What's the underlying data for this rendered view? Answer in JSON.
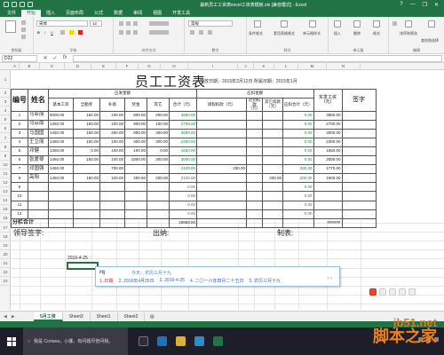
{
  "window": {
    "title": "最新员工工资表excel工资表模板.xls [兼容模式] - Excel",
    "minimize": "—",
    "restore": "❐",
    "close": "✕",
    "help": "?"
  },
  "tabs": [
    "文件",
    "开始",
    "插入",
    "页面布局",
    "公式",
    "数据",
    "审阅",
    "视图",
    "开发工具"
  ],
  "active_tab": "开始",
  "ribbon": {
    "groups": [
      "剪贴板",
      "字体",
      "对齐方式",
      "数字",
      "样式",
      "单元格",
      "编辑"
    ],
    "font_name": "宋体",
    "font_size": "12",
    "number_format": "常规",
    "styles": [
      "条件格式",
      "套用表格格式",
      "单元格样式"
    ],
    "cells": [
      "插入",
      "删除",
      "格式"
    ],
    "editing": [
      "排序和筛选",
      "查找和选择"
    ]
  },
  "formula_bar": {
    "name_box": "D22",
    "cancel": "✕",
    "enter": "✓",
    "fx": "fx"
  },
  "columns": [
    "A",
    "B",
    "C",
    "D",
    "E",
    "F",
    "G",
    "H",
    "I",
    "J",
    "K",
    "L",
    "M",
    "N"
  ],
  "rows": [
    "1",
    "2",
    "3",
    "4",
    "5",
    "6",
    "7",
    "8",
    "9",
    "10",
    "11",
    "12",
    "13",
    "14",
    "15",
    "16",
    "17",
    "18",
    "19",
    "20",
    "21",
    "22",
    "23"
  ],
  "sheet": {
    "title": "员工工资表",
    "subtitle": "发放日期：2015年2月12日  所属日期：2015年1月",
    "headers": {
      "seq": "编号",
      "name": "姓名",
      "due_group": "应发金额",
      "deduct_group": "应扣金额",
      "actual": "实发工资（元）",
      "sign": "签字",
      "due_cols": [
        "基本工资",
        "全勤奖",
        "补助",
        "奖金",
        "其它",
        "合计（元）"
      ],
      "deduct_cols": [
        "请假扣款（元）",
        "迟到扣款（元）",
        "其它扣款（元）",
        "应扣合计（元）"
      ]
    },
    "data_rows": [
      {
        "seq": "1",
        "name": "马亚丽",
        "c1": "8000.00",
        "c2": "150.00",
        "c3": "100.00",
        "c4": "800.00",
        "c5": "200.00",
        "total": "3850.00",
        "d1": "",
        "d2": "",
        "d3": "",
        "dtotal": "0.00",
        "actual": "3850.00"
      },
      {
        "seq": "2",
        "name": "马云南",
        "c1": "1450.00",
        "c2": "150.00",
        "c3": "100.00",
        "c4": "900.00",
        "c5": "100.00",
        "total": "2700.00",
        "d1": "",
        "d2": "",
        "d3": "",
        "dtotal": "0.00",
        "actual": "2700.00"
      },
      {
        "seq": "3",
        "name": "马国国",
        "c1": "1450.00",
        "c2": "150.00",
        "c3": "200.00",
        "c4": "900.00",
        "c5": "300.00",
        "total": "3000.00",
        "d1": "",
        "d2": "",
        "d3": "",
        "dtotal": "0.00",
        "actual": "3000.00"
      },
      {
        "seq": "4",
        "name": "王立丽",
        "c1": "1450.00",
        "c2": "150.00",
        "c3": "100.00",
        "c4": "300.00",
        "c5": "300.00",
        "total": "2300.00",
        "d1": "",
        "d2": "",
        "d3": "",
        "dtotal": "0.00",
        "actual": "2300.00"
      },
      {
        "seq": "5",
        "name": "邓健",
        "c1": "1450.00",
        "c2": "0.00",
        "c3": "100.00",
        "c4": "100.00",
        "c5": "0.00",
        "total": "1650.00",
        "d1": "",
        "d2": "",
        "d3": "",
        "dtotal": "0.00",
        "actual": "1650.00"
      },
      {
        "seq": "6",
        "name": "张爱琴",
        "c1": "1450.00",
        "c2": "150.00",
        "c3": "100.00",
        "c4": "1000.00",
        "c5": "300.00",
        "total": "3000.00",
        "d1": "",
        "d2": "",
        "d3": "",
        "dtotal": "0.00",
        "actual": "3000.00"
      },
      {
        "seq": "7",
        "name": "邓国强",
        "c1": "1450.00",
        "c2": "",
        "c3": "700.00",
        "c4": "",
        "c5": "",
        "total": "2100.00",
        "d1": "330.00",
        "d2": "",
        "d3": "",
        "dtotal": "330.00",
        "actual": "1770.00"
      },
      {
        "seq": "8",
        "name": "高阳",
        "c1": "1450.00",
        "c2": "150.00",
        "c3": "100.00",
        "c4": "200.00",
        "c5": "200.00",
        "total": "2100.00",
        "d1": "",
        "d2": "",
        "d3": "200.00",
        "dtotal": "200.00",
        "actual": "1900.00"
      },
      {
        "seq": "9",
        "name": "",
        "c1": "",
        "c2": "",
        "c3": "",
        "c4": "",
        "c5": "",
        "total": "0.00",
        "d1": "",
        "d2": "",
        "d3": "",
        "dtotal": "0.00",
        "actual": ""
      },
      {
        "seq": "10",
        "name": "",
        "c1": "",
        "c2": "",
        "c3": "",
        "c4": "",
        "c5": "",
        "total": "0.00",
        "d1": "",
        "d2": "",
        "d3": "",
        "dtotal": "0.00",
        "actual": ""
      },
      {
        "seq": "11",
        "name": "",
        "c1": "",
        "c2": "",
        "c3": "",
        "c4": "",
        "c5": "",
        "total": "0.00",
        "d1": "",
        "d2": "",
        "d3": "",
        "dtotal": "0.00",
        "actual": ""
      },
      {
        "seq": "12",
        "name": "",
        "c1": "",
        "c2": "",
        "c3": "",
        "c4": "",
        "c5": "",
        "total": "0.00",
        "d1": "",
        "d2": "",
        "d3": "",
        "dtotal": "0.00",
        "actual": ""
      }
    ],
    "subtotal_label": "分栏合计",
    "subtotal_total": "20850.00",
    "subtotal_actual": "######",
    "signatures": [
      "领导签字:",
      "出纳:",
      "制表:"
    ],
    "typed_date": "2016-4-25"
  },
  "ime": {
    "pinyin": "rq",
    "hint": "今天：农历三月十九",
    "candidates": [
      "1. 日期",
      "2. 2016年4月25日",
      "3. 2016-4-25",
      "4. 二〇一六年四月二十五日",
      "5. 农历三月十九"
    ],
    "arrows": "‹ ›"
  },
  "sheet_tabs": [
    "5月工资",
    "Sheet3",
    "Sheet1",
    "Sheet2"
  ],
  "active_sheet": "5月工资",
  "taskbar": {
    "search_text": "我是 Cortana，小娜。有问题尽管问我。"
  },
  "watermark": {
    "site": "jb51.net",
    "brand": "脚本之家"
  },
  "colors": {
    "excel_green": "#217346",
    "ime_red": "#e02020",
    "watermark": "#ef7f1a"
  }
}
